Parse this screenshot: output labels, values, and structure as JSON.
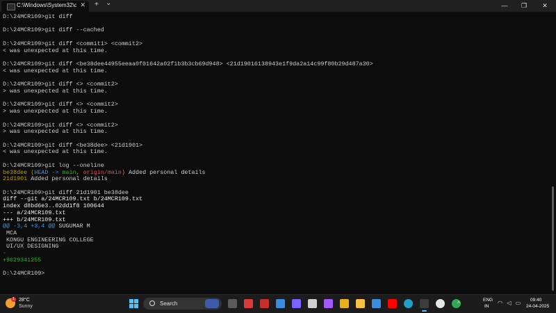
{
  "window": {
    "tab_title": "C:\\Windows\\System32\\cmd.e",
    "tab_close": "✕",
    "new_tab": "+",
    "dropdown": "⌄",
    "minimize": "—",
    "maximize": "❐",
    "close": "✕"
  },
  "terminal": {
    "lines": [
      [
        {
          "t": "D:\\24MCR109>git diff",
          "c": ""
        }
      ],
      [],
      [
        {
          "t": "D:\\24MCR109>git diff --cached",
          "c": ""
        }
      ],
      [],
      [
        {
          "t": "D:\\24MCR109>git diff <commit1> <commit2>",
          "c": ""
        }
      ],
      [
        {
          "t": "< was unexpected at this time.",
          "c": ""
        }
      ],
      [],
      [
        {
          "t": "D:\\24MCR109>git diff <be38dee44955eeaa0f01642a02f1b3b3cb69d948> <21d19016138943e1f9da2a14c99f80b29d487a30>",
          "c": ""
        }
      ],
      [
        {
          "t": "< was unexpected at this time.",
          "c": ""
        }
      ],
      [],
      [
        {
          "t": "D:\\24MCR109>git diff <> <commit2>",
          "c": ""
        }
      ],
      [
        {
          "t": "> was unexpected at this time.",
          "c": ""
        }
      ],
      [],
      [
        {
          "t": "D:\\24MCR109>git diff <> <commit2>",
          "c": ""
        }
      ],
      [
        {
          "t": "> was unexpected at this time.",
          "c": ""
        }
      ],
      [],
      [
        {
          "t": "D:\\24MCR109>git diff <> <commit2>",
          "c": ""
        }
      ],
      [
        {
          "t": "> was unexpected at this time.",
          "c": ""
        }
      ],
      [],
      [
        {
          "t": "D:\\24MCR109>git diff <be38dee> <21d1901>",
          "c": ""
        }
      ],
      [
        {
          "t": "< was unexpected at this time.",
          "c": ""
        }
      ],
      [],
      [
        {
          "t": "D:\\24MCR109>git log --oneline",
          "c": ""
        }
      ],
      [
        {
          "t": "be38dee",
          "c": "c-yellow"
        },
        {
          "t": " (",
          "c": "c-yellow"
        },
        {
          "t": "HEAD -> ",
          "c": "c-cyan"
        },
        {
          "t": "main",
          "c": "c-green"
        },
        {
          "t": ", ",
          "c": "c-yellow"
        },
        {
          "t": "origin/main",
          "c": "c-red"
        },
        {
          "t": ")",
          "c": "c-yellow"
        },
        {
          "t": " Added personal details",
          "c": ""
        }
      ],
      [
        {
          "t": "21d1901",
          "c": "c-yellow"
        },
        {
          "t": " Added personal details",
          "c": ""
        }
      ],
      [],
      [
        {
          "t": "D:\\24MCR109>git diff 21d1901 be38dee",
          "c": ""
        }
      ],
      [
        {
          "t": "diff --git a/24MCR109.txt b/24MCR109.txt",
          "c": "c-bold"
        }
      ],
      [
        {
          "t": "index d8bd6e3..02dd1f8 100644",
          "c": "c-bold"
        }
      ],
      [
        {
          "t": "--- a/24MCR109.txt",
          "c": "c-bold"
        }
      ],
      [
        {
          "t": "+++ b/24MCR109.txt",
          "c": "c-bold"
        }
      ],
      [
        {
          "t": "@@ -3,4 +3,4 @@",
          "c": "c-cyan"
        },
        {
          "t": " SUGUMAR M",
          "c": ""
        }
      ],
      [
        {
          "t": " MCA",
          "c": ""
        }
      ],
      [
        {
          "t": " KONGU ENGINEERING COLLEGE",
          "c": ""
        }
      ],
      [
        {
          "t": " UI/UX DESIGNING",
          "c": ""
        }
      ],
      [
        {
          "t": "-",
          "c": "c-red"
        }
      ],
      [
        {
          "t": "+9629341255",
          "c": "c-green"
        }
      ],
      [],
      [
        {
          "t": "D:\\24MCR109>",
          "c": ""
        }
      ]
    ]
  },
  "taskbar": {
    "weather_temp": "28°C",
    "weather_desc": "Sunny",
    "weather_badge": "1",
    "search_label": "Search",
    "tray_arrow": "^",
    "lang": "ENG",
    "region": "IN",
    "tray_icons": "◠ ◁ ▭",
    "time": "09:40",
    "date": "24-04-2025",
    "apps": [
      {
        "name": "task-view-icon",
        "color": "#5a5a5a"
      },
      {
        "name": "security-app-icon",
        "color": "#d83b3b"
      },
      {
        "name": "pdf-app-icon",
        "color": "#c4302b"
      },
      {
        "name": "chart-app-icon",
        "color": "#3a8dde"
      },
      {
        "name": "media-app-icon",
        "color": "#7b61ff"
      },
      {
        "name": "calendar-app-icon",
        "color": "#d0d0d0"
      },
      {
        "name": "design-app-icon",
        "color": "#a259ff"
      },
      {
        "name": "chrome-profile-icon",
        "color": "#e8b019"
      },
      {
        "name": "file-explorer-icon",
        "color": "#f4c242"
      },
      {
        "name": "store-icon",
        "color": "#3a8dde"
      },
      {
        "name": "youtube-icon",
        "color": "#ff0000"
      },
      {
        "name": "edge-icon",
        "color": "#1fa0c8"
      },
      {
        "name": "terminal-icon",
        "color": "#3c3c3c"
      },
      {
        "name": "chatgpt-icon",
        "color": "#e6e6e6"
      },
      {
        "name": "chrome-icon",
        "color": "#34a853"
      }
    ]
  }
}
